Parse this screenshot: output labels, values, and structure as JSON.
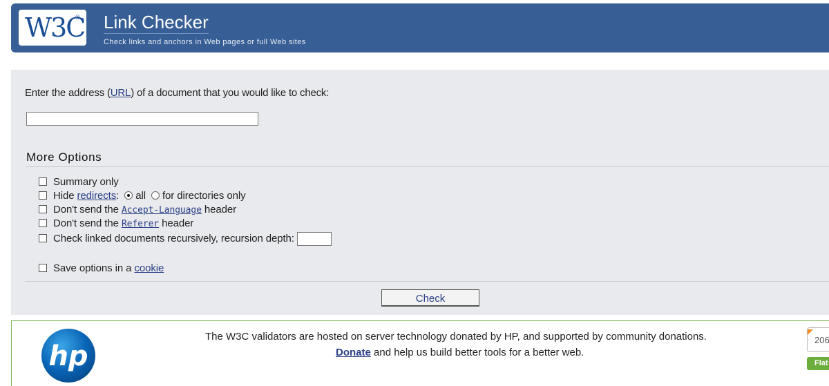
{
  "banner": {
    "logo_text": "W3C",
    "logo_reg": "®",
    "title": "Link Checker",
    "subtitle": "Check links and anchors in Web pages or full Web sites"
  },
  "form": {
    "prompt_before": "Enter the address (",
    "prompt_link": "URL",
    "prompt_after": ") of a document that you would like to check:",
    "url_value": "",
    "more_options_title": "More Options",
    "options": {
      "summary_only": "Summary only",
      "hide_label": "Hide ",
      "redirects_link": "redirects",
      "hide_colon": ":",
      "radio_all": "all",
      "radio_dirs": "for directories only",
      "no_accept_pre": "Don't send the ",
      "accept_language": "Accept-Language",
      "header_word": " header",
      "no_referer_pre": "Don't send the ",
      "referer": "Referer",
      "recursive": "Check linked documents recursively, recursion depth:",
      "save_pre": "Save options in a ",
      "cookie_link": "cookie"
    },
    "radio_selected": "all",
    "check_button": "Check"
  },
  "sponsor": {
    "line1": "The W3C validators are hosted on server technology donated by HP, and supported by community donations.",
    "donate_link": "Donate",
    "line2_rest": " and help us build better tools for a better web.",
    "hp_logo": "hp",
    "flattr_count": "206",
    "flattr_label": "Flat"
  },
  "colors": {
    "banner": "#375e95",
    "panel": "#e9eaed",
    "link": "#2a3f86",
    "sponsor_border": "#7fb75a"
  }
}
